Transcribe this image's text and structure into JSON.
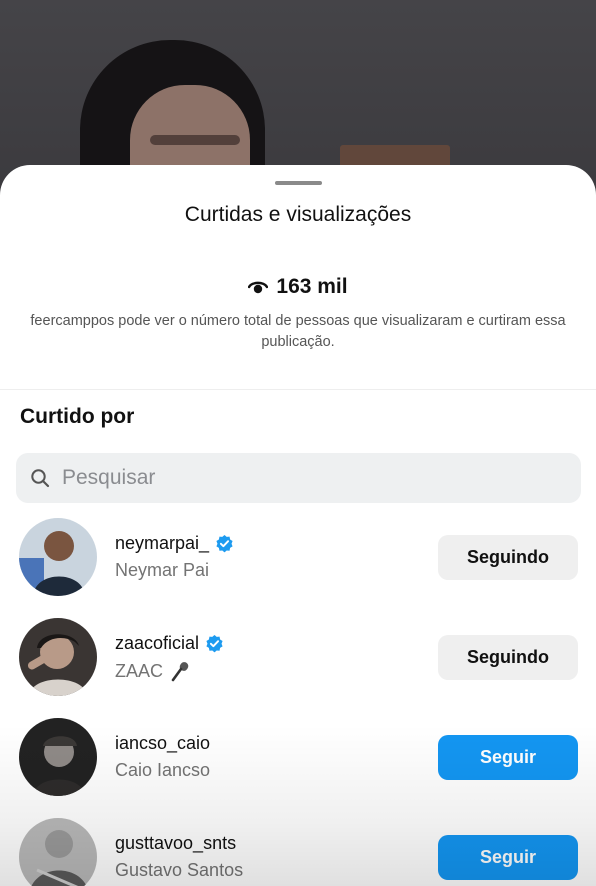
{
  "sheet": {
    "title": "Curtidas e visualizações",
    "views_count": "163 mil",
    "description": "feercamppos pode ver o número total de pessoas que visualizaram e curtiram essa publicação."
  },
  "section": {
    "title": "Curtido por"
  },
  "search": {
    "placeholder": "Pesquisar",
    "value": ""
  },
  "users": [
    {
      "username": "neymarpai_",
      "fullname": "Neymar Pai",
      "verified": true,
      "button": "Seguindo"
    },
    {
      "username": "zaacoficial",
      "fullname": "ZAAC",
      "verified": true,
      "button": "Seguindo",
      "name_icon": "microphone-icon"
    },
    {
      "username": "iancso_caio",
      "fullname": "Caio Iancso",
      "verified": false,
      "button": "Seguir"
    },
    {
      "username": "gusttavoo_snts",
      "fullname": "Gustavo Santos",
      "verified": false,
      "button": "Seguir"
    }
  ],
  "colors": {
    "follow_button": "#1396f2",
    "following_button": "#efefef",
    "verified_badge": "#1d9bf0"
  }
}
